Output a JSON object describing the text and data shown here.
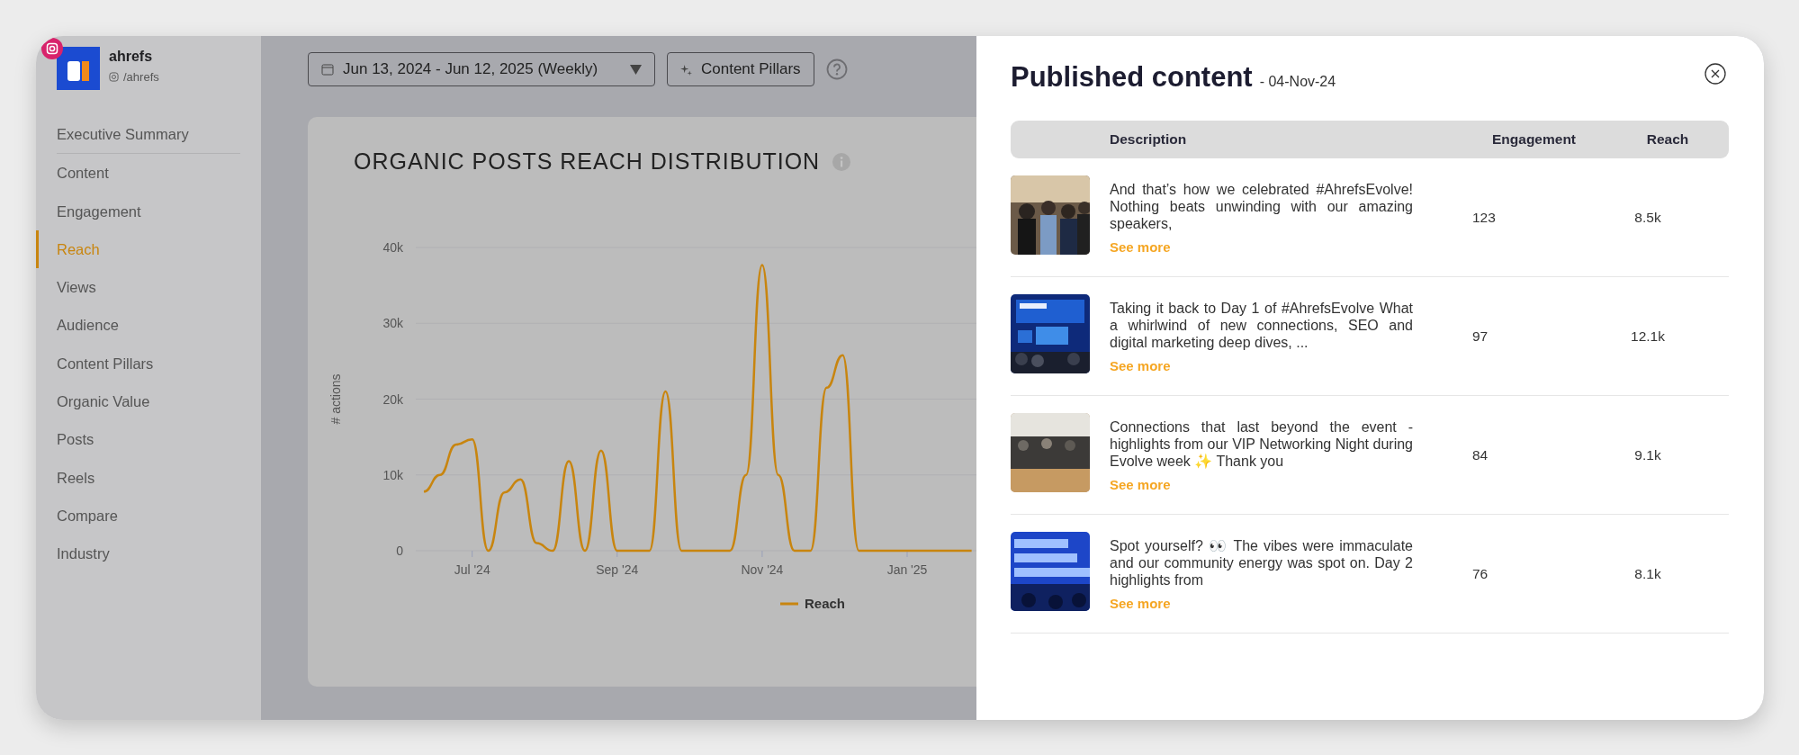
{
  "account": {
    "name": "ahrefs",
    "handle": "/ahrefs"
  },
  "nav": [
    {
      "items": [
        {
          "label": "Executive Summary",
          "selected": false
        }
      ]
    },
    {
      "items": [
        {
          "label": "Content",
          "selected": false
        },
        {
          "label": "Engagement",
          "selected": false
        },
        {
          "label": "Reach",
          "selected": true
        },
        {
          "label": "Views",
          "selected": false
        },
        {
          "label": "Audience",
          "selected": false
        },
        {
          "label": "Content Pillars",
          "selected": false
        },
        {
          "label": "Organic Value",
          "selected": false
        },
        {
          "label": "Posts",
          "selected": false
        },
        {
          "label": "Reels",
          "selected": false
        },
        {
          "label": "Compare",
          "selected": false
        },
        {
          "label": "Industry",
          "selected": false
        }
      ]
    }
  ],
  "toolbar": {
    "date_range": "Jun 13, 2024 - Jun 12, 2025 (Weekly)",
    "pillars_button": "Content Pillars"
  },
  "chart": {
    "title": "ORGANIC POSTS REACH DISTRIBUTION",
    "chart_data": {
      "type": "line",
      "ylabel": "# actions",
      "categories": [
        null,
        null,
        null,
        "Jul '24",
        null,
        null,
        null,
        null,
        null,
        null,
        null,
        null,
        "Sep '24",
        null,
        null,
        null,
        null,
        null,
        null,
        null,
        null,
        "Nov '24",
        null,
        null,
        null,
        null,
        null,
        null,
        null,
        null,
        "Jan '25",
        null,
        null,
        null,
        null
      ],
      "series": [
        {
          "name": "Reach",
          "color": "#c8850f",
          "values": [
            7800,
            10000,
            14000,
            14700,
            0,
            7700,
            9400,
            1000,
            0,
            11800,
            0,
            13200,
            0,
            0,
            0,
            21000,
            0,
            0,
            0,
            0,
            10000,
            37700,
            10000,
            0,
            0,
            21500,
            25800,
            0,
            0,
            0,
            0,
            0,
            0,
            0,
            0
          ]
        }
      ],
      "ylim": [
        0,
        40000
      ],
      "grid": true,
      "yticks": [
        {
          "value": 0,
          "label": "0"
        },
        {
          "value": 10000,
          "label": "10k"
        },
        {
          "value": 20000,
          "label": "20k"
        },
        {
          "value": 30000,
          "label": "30k"
        },
        {
          "value": 40000,
          "label": "40k"
        }
      ]
    }
  },
  "panel": {
    "title": "Published content",
    "date": "- 04-Nov-24",
    "columns": [
      "Description",
      "Engagement",
      "Reach"
    ],
    "rows": [
      {
        "description": "And that’s how we celebrated #AhrefsEvolve! Nothing beats unwinding with our amazing speakers,",
        "link": "See more",
        "engagement": "123",
        "reach": "8.5k"
      },
      {
        "description": "Taking it back to Day 1 of #AhrefsEvolve What a whirlwind of new connections, SEO and digital marketing deep dives, ...",
        "link": "See more",
        "engagement": "97",
        "reach": "12.1k"
      },
      {
        "description": "Connections that last beyond the event - highlights from our VIP Networking Night during Evolve week ✨ Thank you",
        "link": "See more",
        "engagement": "84",
        "reach": "9.1k"
      },
      {
        "description": "Spot yourself? 👀  The vibes were immaculate and our community energy was spot on. Day 2 highlights from",
        "link": "See more",
        "engagement": "76",
        "reach": "8.1k"
      }
    ]
  }
}
